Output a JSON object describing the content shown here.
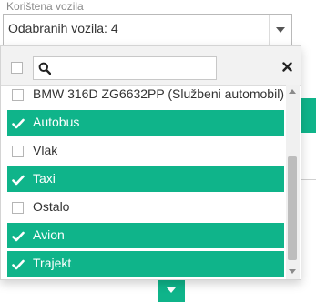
{
  "field": {
    "label": "Korištena vozila",
    "value": "Odabranih vozila: 4"
  },
  "dropdown": {
    "search": {
      "value": "",
      "placeholder": ""
    },
    "items": [
      {
        "label": "BMW 316D ZG6632PP (Službeni automobil)",
        "selected": false
      },
      {
        "label": "Autobus",
        "selected": true
      },
      {
        "label": "Vlak",
        "selected": false
      },
      {
        "label": "Taxi",
        "selected": true
      },
      {
        "label": "Ostalo",
        "selected": false
      },
      {
        "label": "Avion",
        "selected": true
      },
      {
        "label": "Trajekt",
        "selected": true
      }
    ]
  },
  "colors": {
    "accent": "#0fb48a",
    "border": "#b9b9b9",
    "text": "#333333"
  },
  "icons": {
    "search": "search-icon",
    "clear": "close-icon",
    "check": "check-icon",
    "caret": "chevron-down-icon"
  }
}
